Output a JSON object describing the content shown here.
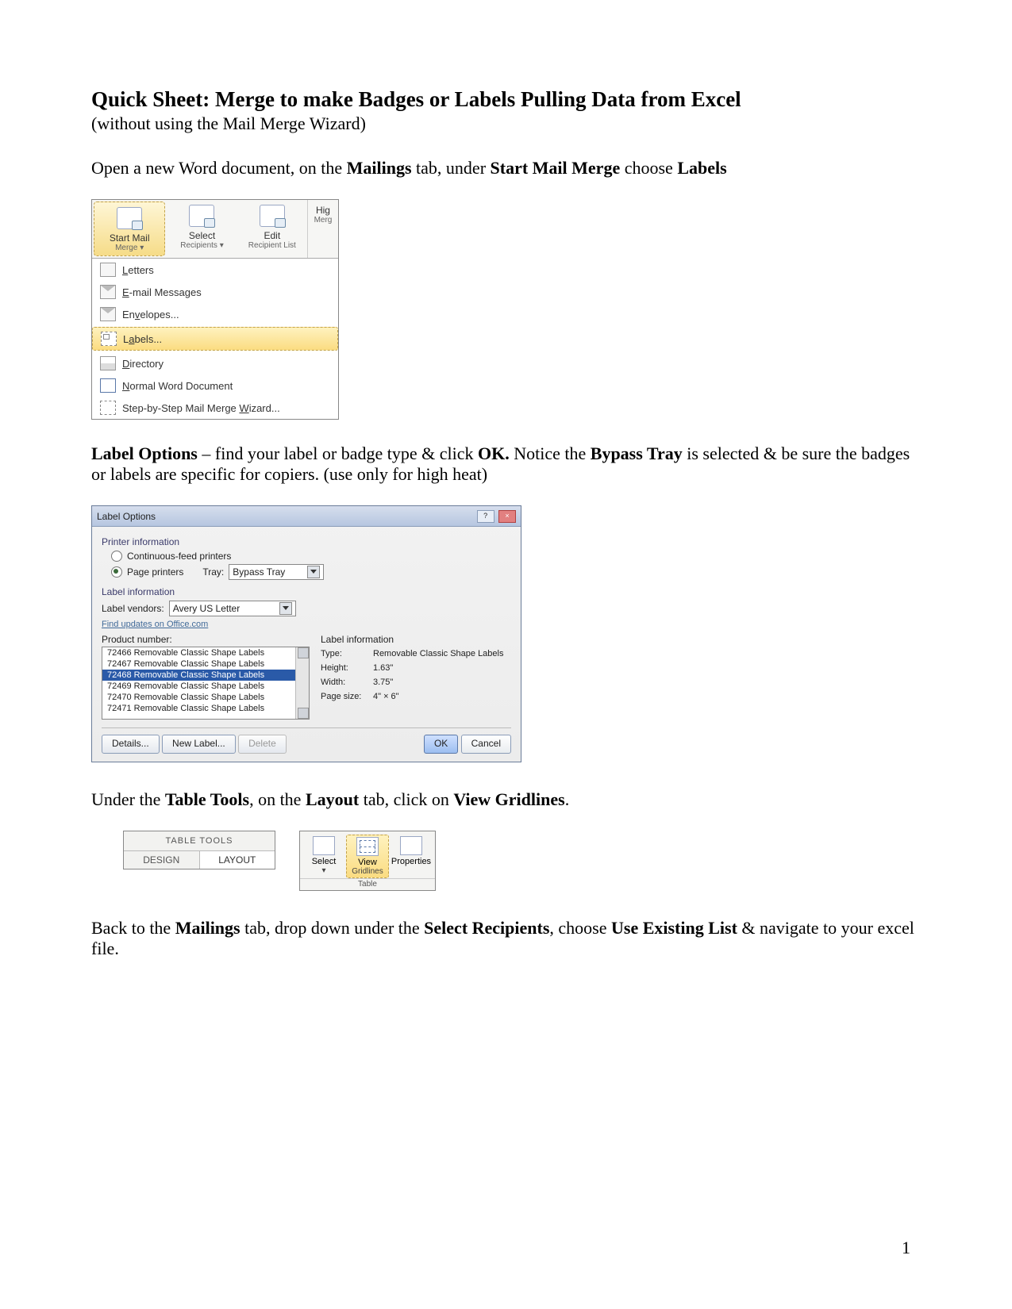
{
  "title": "Quick Sheet: Merge to make Badges or Labels Pulling Data from Excel",
  "subtitle": "(without using the Mail Merge Wizard)",
  "p1": {
    "a": "Open a new Word document, on the ",
    "b": "Mailings",
    "c": " tab, under ",
    "d": "Start Mail Merge",
    "e": " choose ",
    "f": "Labels"
  },
  "ribbon": {
    "btn1_l1": "Start Mail",
    "btn1_l2": "Merge ▾",
    "btn2_l1": "Select",
    "btn2_l2": "Recipients ▾",
    "btn3_l1": "Edit",
    "btn3_l2": "Recipient List",
    "btn4_l1": "Hig",
    "btn4_l2": "Merg"
  },
  "dd": [
    {
      "icon": "letter",
      "text": "Letters",
      "u": "L"
    },
    {
      "icon": "env",
      "text": "E-mail Messages",
      "u": "E"
    },
    {
      "icon": "env",
      "text": "Envelopes...",
      "u": "v"
    },
    {
      "icon": "lab-sel",
      "text": "Labels...",
      "u": "A",
      "selected": true
    },
    {
      "icon": "dir",
      "text": "Directory",
      "u": "D"
    },
    {
      "icon": "norm",
      "text": "Normal Word Document",
      "u": "N"
    },
    {
      "icon": "wiz",
      "text": "Step-by-Step Mail Merge Wizard...",
      "u": "W"
    }
  ],
  "p2": {
    "a": "Label Options",
    "b": " – find your label or badge type & click ",
    "c": "OK.",
    "d": " Notice the ",
    "e": "Bypass Tray",
    "f": " is selected & be sure the badges or labels are specific for copiers. (use only for high heat)"
  },
  "dlg": {
    "title": "Label Options",
    "sec1": "Printer information",
    "r1": "Continuous-feed printers",
    "r2": "Page printers",
    "trayLabel": "Tray:",
    "trayValue": "Bypass Tray",
    "sec2": "Label information",
    "vendorsLabel": "Label vendors:",
    "vendorsValue": "Avery US Letter",
    "officeLink": "Find updates on Office.com",
    "prodHdr": "Product number:",
    "infoHdr": "Label information",
    "products": [
      "72466 Removable Classic Shape Labels",
      "72467 Removable Classic Shape Labels",
      "72468 Removable Classic Shape Labels",
      "72469 Removable Classic Shape Labels",
      "72470 Removable Classic Shape Labels",
      "72471 Removable Classic Shape Labels"
    ],
    "selectedProductIndex": 2,
    "info": {
      "Type": "Removable Classic Shape Labels",
      "Height": "1.63\"",
      "Width": "3.75\"",
      "Page_size": "4\" × 6\""
    },
    "btnDetails": "Details...",
    "btnNew": "New Label...",
    "btnDelete": "Delete",
    "btnOK": "OK",
    "btnCancel": "Cancel"
  },
  "p3": {
    "a": "Under the ",
    "b": "Table Tools",
    "c": ", on the ",
    "d": "Layout",
    "e": " tab, click on ",
    "f": "View Gridlines",
    "g": "."
  },
  "tt": {
    "title": "TABLE TOOLS",
    "tab1": "DESIGN",
    "tab2": "LAYOUT"
  },
  "gl": {
    "btn1_l1": "Select",
    "btn1_l2": "▾",
    "btn2_l1": "View",
    "btn2_l2": "Gridlines",
    "btn3_l1": "Properties",
    "group": "Table"
  },
  "p4": {
    "a": "Back to the ",
    "b": "Mailings",
    "c": " tab, drop down under the ",
    "d": "Select Recipients",
    "e": ", choose ",
    "f": "Use Existing List",
    "g": " & navigate to your excel file."
  },
  "pagenum": "1"
}
